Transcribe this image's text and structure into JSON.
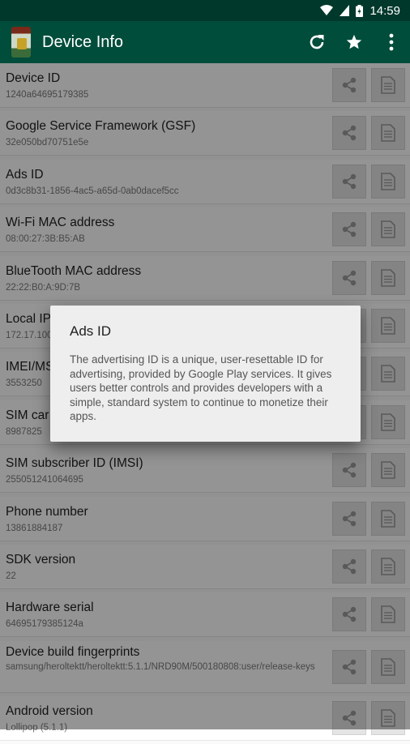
{
  "status_bar": {
    "time": "14:59"
  },
  "app_bar": {
    "title": "Device Info",
    "actions": [
      "refresh-icon",
      "star-icon",
      "more-vertical-icon"
    ]
  },
  "rows": [
    {
      "label": "Device ID",
      "value": "1240a64695179385"
    },
    {
      "label": "Google Service Framework (GSF)",
      "value": "32e050bd70751e5e"
    },
    {
      "label": "Ads ID",
      "value": "0d3c8b31-1856-4ac5-a65d-0ab0dacef5cc"
    },
    {
      "label": "Wi-Fi MAC address",
      "value": "08:00:27:3B:B5:AB"
    },
    {
      "label": "BlueTooth MAC address",
      "value": "22:22:B0:A:9D:7B"
    },
    {
      "label": "Local IP",
      "value": "172.17.100"
    },
    {
      "label": "IMEI/MS",
      "value": "3553250"
    },
    {
      "label": "SIM car",
      "value": "8987825"
    },
    {
      "label": "SIM subscriber ID (IMSI)",
      "value": "255051241064695"
    },
    {
      "label": "Phone number",
      "value": "13861884187"
    },
    {
      "label": "SDK version",
      "value": "22"
    },
    {
      "label": "Hardware serial",
      "value": "64695179385124a"
    },
    {
      "label": "Device build fingerprints",
      "value": "samsung/heroltektt/heroltektt:5.1.1/NRD90M/500180808:user/release-keys",
      "tall": true
    },
    {
      "label": "Android version",
      "value": "Lollipop (5.1.1)"
    }
  ],
  "dialog": {
    "title": "Ads ID",
    "body": "The advertising ID is a unique, user-resettable ID for advertising, provided by Google Play services. It gives users better controls and provides developers with a simple, standard system to continue to monetize their apps."
  },
  "colors": {
    "status_bar": "#00382b",
    "app_bar": "#004d3c",
    "dialog_bg": "#eeeeee"
  }
}
